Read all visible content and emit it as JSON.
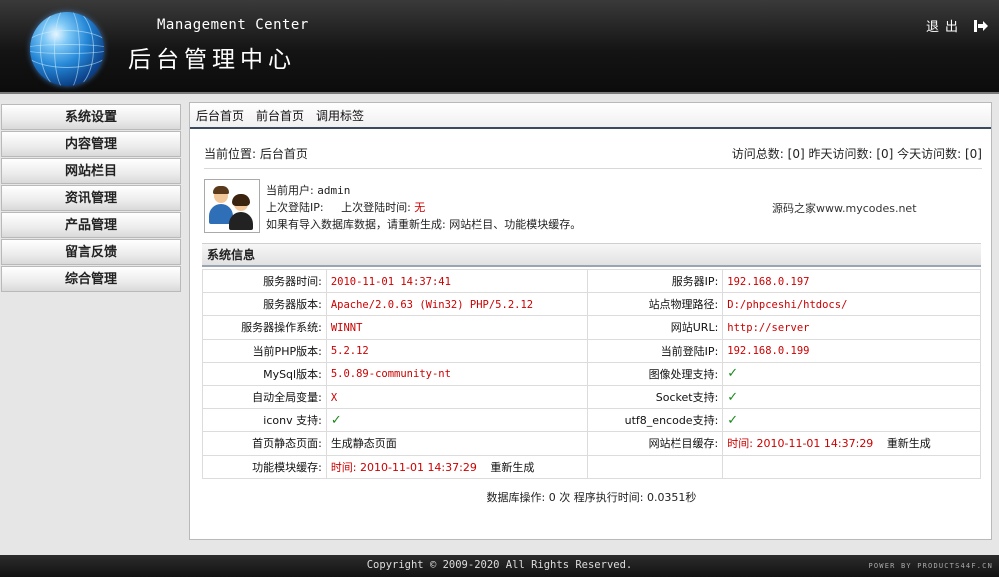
{
  "header": {
    "title_en": "Management Center",
    "title_cn": "后台管理中心",
    "logout_label": "退出"
  },
  "sidebar": {
    "items": [
      {
        "label": "系统设置"
      },
      {
        "label": "内容管理"
      },
      {
        "label": "网站栏目"
      },
      {
        "label": "资讯管理"
      },
      {
        "label": "产品管理"
      },
      {
        "label": "留言反馈"
      },
      {
        "label": "综合管理"
      }
    ]
  },
  "tabs": [
    {
      "label": "后台首页"
    },
    {
      "label": "前台首页"
    },
    {
      "label": "调用标签"
    }
  ],
  "location": {
    "current": "当前位置: 后台首页",
    "visits": "访问总数: [0] 昨天访问数: [0] 今天访问数: [0]"
  },
  "user": {
    "current_user_label": "当前用户:",
    "current_user": "admin",
    "last_ip_label": "上次登陆IP:",
    "last_time_label": "上次登陆时间:",
    "last_time_value": "无",
    "notice": "如果有导入数据库数据，请重新生成: 网站栏目、功能模块缓存。",
    "watermark": "源码之家www.mycodes.net"
  },
  "system_info": {
    "title": "系统信息",
    "rows": [
      {
        "l1": "服务器时间:",
        "v1": "2010-11-01 14:37:41",
        "l2": "服务器IP:",
        "v2": "192.168.0.197"
      },
      {
        "l1": "服务器版本:",
        "v1": "Apache/2.0.63 (Win32) PHP/5.2.12",
        "l2": "站点物理路径:",
        "v2": "D:/phpceshi/htdocs/"
      },
      {
        "l1": "服务器操作系统:",
        "v1": "WINNT",
        "l2": "网站URL:",
        "v2": "http://server"
      },
      {
        "l1": "当前PHP版本:",
        "v1": "5.2.12",
        "l2": "当前登陆IP:",
        "v2": "192.168.0.199"
      },
      {
        "l1": "MySql版本:",
        "v1": "5.0.89-community-nt",
        "l2": "图像处理支持:",
        "v2": "✓"
      },
      {
        "l1": "自动全局变量:",
        "v1": "X",
        "l2": "Socket支持:",
        "v2": "✓"
      },
      {
        "l1": "iconv 支持:",
        "v1": "✓",
        "l2": "utf8_encode支持:",
        "v2": "✓"
      },
      {
        "l1": "首页静态页面:",
        "v1": "生成静态页面",
        "l2": "网站栏目缓存:",
        "v2_time": "时间: 2010-11-01 14:37:29",
        "v2_action": "重新生成"
      },
      {
        "l1": "功能模块缓存:",
        "v1_time": "时间: 2010-11-01 14:37:29",
        "v1_action": "重新生成",
        "l2": "",
        "v2": ""
      }
    ]
  },
  "stats": "数据库操作: 0 次 程序执行时间: 0.0351秒",
  "footer": {
    "copyright": "Copyright © 2009-2020 All Rights Reserved.",
    "powered": "POWER BY PRODUCTS44F.CN"
  }
}
